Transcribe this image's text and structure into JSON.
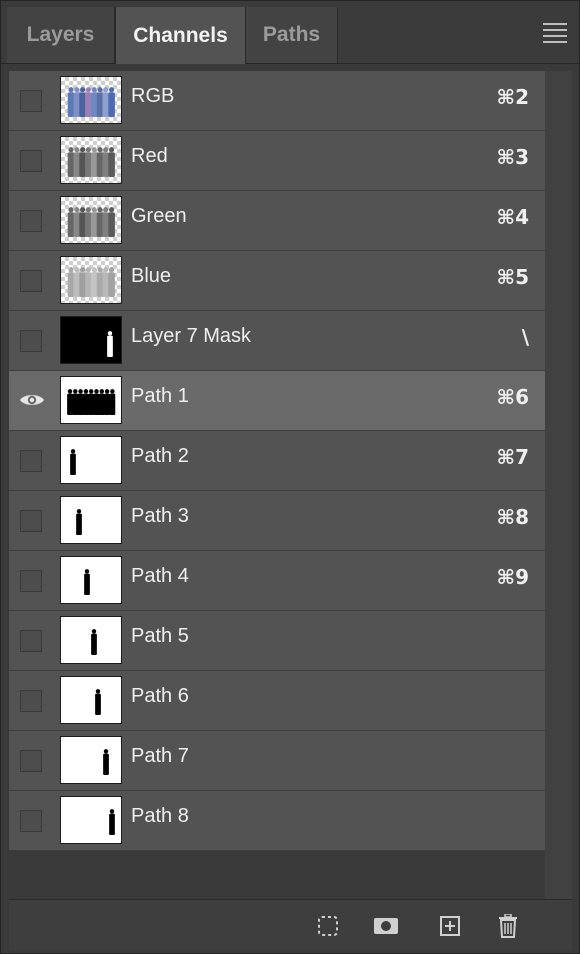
{
  "tabs": [
    {
      "label": "Layers",
      "active": false
    },
    {
      "label": "Channels",
      "active": true
    },
    {
      "label": "Paths",
      "active": false
    }
  ],
  "channels": [
    {
      "name": "RGB",
      "shortcut": "⌘2",
      "thumb": "rgb-group",
      "visible": false
    },
    {
      "name": "Red",
      "shortcut": "⌘3",
      "thumb": "gray-group",
      "visible": false
    },
    {
      "name": "Green",
      "shortcut": "⌘4",
      "thumb": "gray-group",
      "visible": false
    },
    {
      "name": "Blue",
      "shortcut": "⌘5",
      "thumb": "lightgray-group",
      "visible": false
    },
    {
      "name": "Layer 7 Mask",
      "shortcut": "\\",
      "thumb": "mask",
      "visible": false
    },
    {
      "name": "Path 1",
      "shortcut": "⌘6",
      "thumb": "silhouette-group",
      "visible": true,
      "selected": true
    },
    {
      "name": "Path 2",
      "shortcut": "⌘7",
      "thumb": "single-figure",
      "visible": false
    },
    {
      "name": "Path 3",
      "shortcut": "⌘8",
      "thumb": "single-figure",
      "visible": false
    },
    {
      "name": "Path 4",
      "shortcut": "⌘9",
      "thumb": "single-figure",
      "visible": false
    },
    {
      "name": "Path 5",
      "shortcut": "",
      "thumb": "single-figure",
      "visible": false
    },
    {
      "name": "Path 6",
      "shortcut": "",
      "thumb": "single-figure",
      "visible": false
    },
    {
      "name": "Path 7",
      "shortcut": "",
      "thumb": "single-figure",
      "visible": false
    },
    {
      "name": "Path 8",
      "shortcut": "",
      "thumb": "single-figure",
      "visible": false
    }
  ],
  "footer_icons": [
    "load-selection-icon",
    "save-mask-icon",
    "new-channel-icon",
    "delete-channel-icon"
  ],
  "colors": {
    "selected_row": "#6a6a6a",
    "row": "#535353",
    "panel": "#3a3a3a"
  }
}
